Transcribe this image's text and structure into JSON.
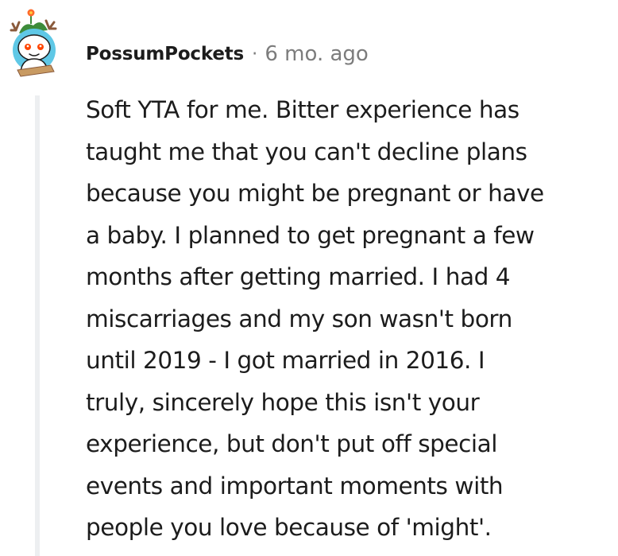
{
  "comment": {
    "author": "PossumPockets",
    "separator": "·",
    "timestamp": "6 mo. ago",
    "avatar_icon": "snoo-reindeer-avatar-icon",
    "body_lines": [
      "Soft YTA for me. Bitter experience has",
      "taught me that you can't decline plans",
      "because you might be pregnant or have",
      "a baby. I planned to get pregnant a few",
      "months after getting married. I had 4",
      "miscarriages and my son wasn't born",
      "until 2019 - I got married in 2016. I",
      "truly, sincerely hope this isn't your",
      "experience, but don't put off special",
      "events and important moments with",
      "people you love because of 'might'."
    ]
  },
  "colors": {
    "text": "#1c1c1c",
    "meta": "#7c7c7c",
    "thread_line": "#edeff1",
    "avatar_bg": "#5fc8e6",
    "antler": "#8a5a3b",
    "leaf": "#3d8c3a",
    "flower": "#ff6a2b"
  }
}
